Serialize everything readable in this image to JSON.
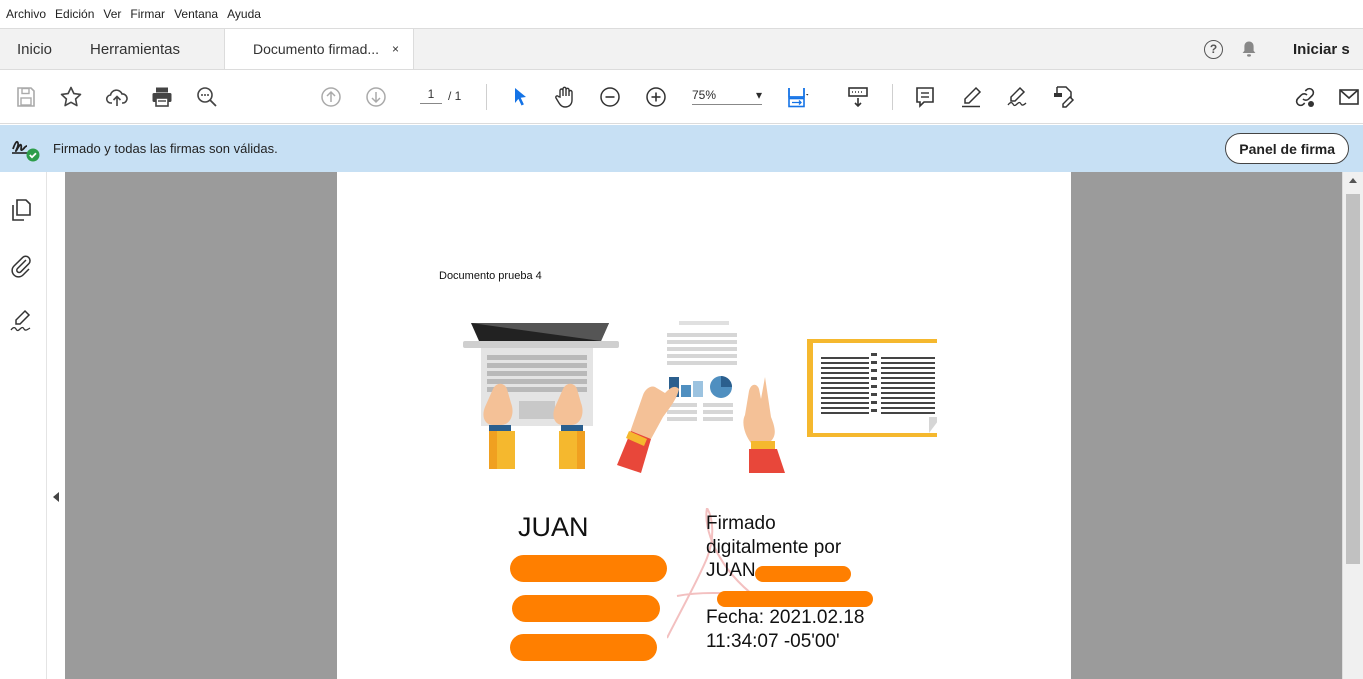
{
  "menu": [
    "Archivo",
    "Edición",
    "Ver",
    "Firmar",
    "Ventana",
    "Ayuda"
  ],
  "tabs": {
    "home": "Inicio",
    "tools": "Herramientas",
    "document": "Documento firmad...",
    "close": "×"
  },
  "header": {
    "help": "?",
    "signin": "Iniciar s"
  },
  "toolbar": {
    "page_current": "1",
    "page_total": "/ 1",
    "zoom": "75%",
    "zoom_arrow": "▾"
  },
  "signature_bar": {
    "message": "Firmado y todas las firmas son válidas.",
    "panel_button": "Panel de firma"
  },
  "document": {
    "title": "Documento prueba 4",
    "signer_name": "JUAN",
    "details": [
      "Firmado",
      "digitalmente por",
      "JUAN",
      "",
      "Fecha: 2021.02.18",
      "11:34:07 -05'00'"
    ]
  },
  "colors": {
    "signature_bar_bg": "#c7e0f4",
    "redaction": "#ff7f00",
    "workspace": "#9b9b9b",
    "selection_blue": "#1473e6"
  }
}
